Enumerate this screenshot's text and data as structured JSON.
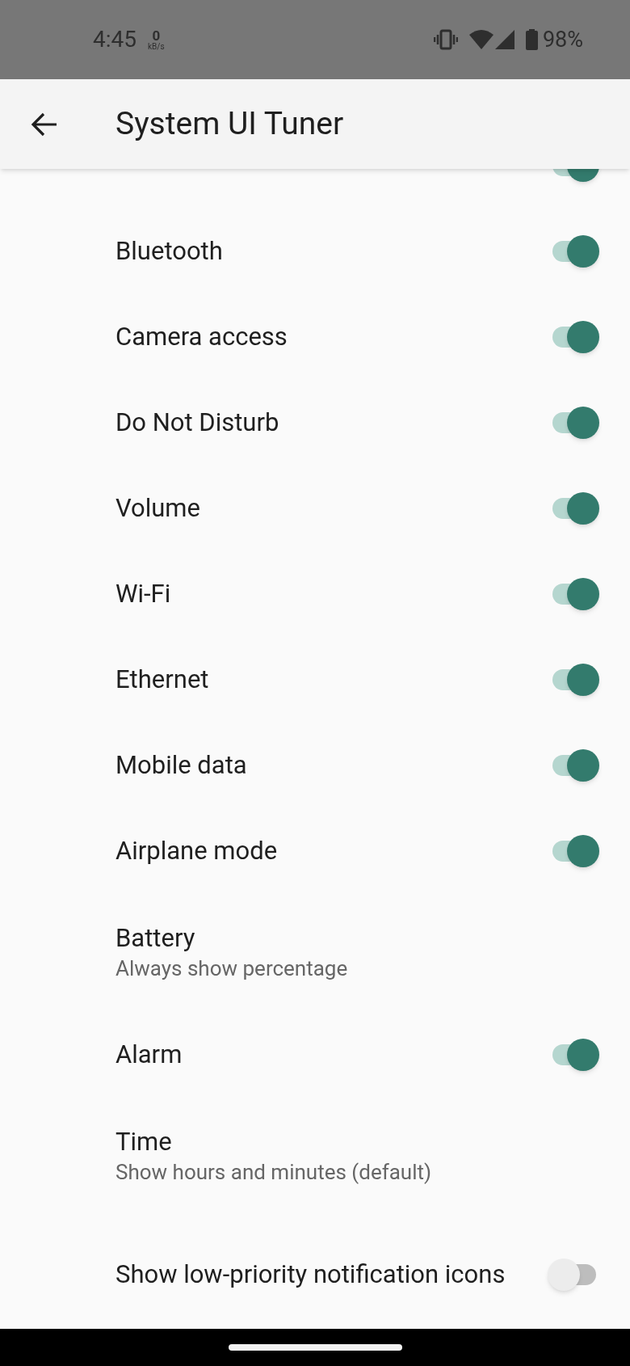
{
  "status_bar": {
    "time": "4:45",
    "speed_value": "0",
    "speed_unit": "kB/s",
    "battery": "98%"
  },
  "app_bar": {
    "title": "System UI Tuner"
  },
  "items": [
    {
      "kind": "switch",
      "on": true
    },
    {
      "kind": "switch",
      "title": "Bluetooth",
      "on": true
    },
    {
      "kind": "switch",
      "title": "Camera access",
      "on": true
    },
    {
      "kind": "switch",
      "title": "Do Not Disturb",
      "on": true
    },
    {
      "kind": "switch",
      "title": "Volume",
      "on": true
    },
    {
      "kind": "switch",
      "title": "Wi-Fi",
      "on": true
    },
    {
      "kind": "switch",
      "title": "Ethernet",
      "on": true
    },
    {
      "kind": "switch",
      "title": "Mobile data",
      "on": true
    },
    {
      "kind": "switch",
      "title": "Airplane mode",
      "on": true
    },
    {
      "kind": "option",
      "title": "Battery",
      "subtitle": "Always show percentage"
    },
    {
      "kind": "switch",
      "title": "Alarm",
      "on": true
    },
    {
      "kind": "option",
      "title": "Time",
      "subtitle": "Show hours and minutes (default)"
    },
    {
      "kind": "switch",
      "title": "Show low-priority notification icons",
      "on": false
    }
  ]
}
